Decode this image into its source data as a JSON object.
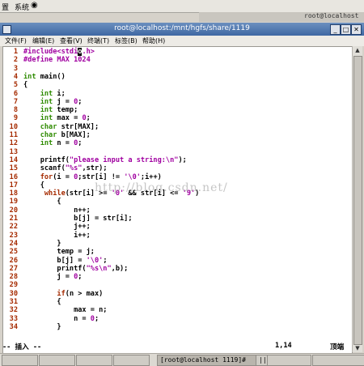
{
  "top_panel": {
    "menu_apps": "置",
    "menu_system": "系统"
  },
  "background_window": {
    "title_fragment": "root@localhost"
  },
  "window": {
    "title": "root@localhost:/mnt/hgfs/share/1119",
    "minimize": "_",
    "maximize": "□",
    "close": "✕"
  },
  "menu": {
    "file": "文件(F)",
    "edit": "编辑(E)",
    "view": "查看(V)",
    "terminal": "终端(T)",
    "tabs": "标签(B)",
    "help": "帮助(H)"
  },
  "colors": {
    "keyword": "#a52a00",
    "type": "#2e8b00",
    "preproc": "#a000a0",
    "string": "#a000a0",
    "number": "#a000a0",
    "plain": "#000000"
  },
  "code": [
    {
      "num": "1",
      "segs": [
        {
          "t": "#include<stdi",
          "c": "preproc"
        },
        {
          "t": "o",
          "c": "cursor"
        },
        {
          "t": ".h>",
          "c": "preproc"
        }
      ]
    },
    {
      "num": "2",
      "segs": [
        {
          "t": "#define MAX 1024",
          "c": "preproc"
        }
      ]
    },
    {
      "num": "3",
      "segs": []
    },
    {
      "num": "4",
      "segs": [
        {
          "t": "int",
          "c": "type"
        },
        {
          "t": " main()",
          "c": "plain"
        }
      ]
    },
    {
      "num": "5",
      "segs": [
        {
          "t": "{",
          "c": "plain"
        }
      ]
    },
    {
      "num": "6",
      "segs": [
        {
          "t": "    ",
          "c": "plain"
        },
        {
          "t": "int",
          "c": "type"
        },
        {
          "t": " i;",
          "c": "plain"
        }
      ]
    },
    {
      "num": "7",
      "segs": [
        {
          "t": "    ",
          "c": "plain"
        },
        {
          "t": "int",
          "c": "type"
        },
        {
          "t": " j = ",
          "c": "plain"
        },
        {
          "t": "0",
          "c": "number"
        },
        {
          "t": ";",
          "c": "plain"
        }
      ]
    },
    {
      "num": "8",
      "segs": [
        {
          "t": "    ",
          "c": "plain"
        },
        {
          "t": "int",
          "c": "type"
        },
        {
          "t": " temp;",
          "c": "plain"
        }
      ]
    },
    {
      "num": "9",
      "segs": [
        {
          "t": "    ",
          "c": "plain"
        },
        {
          "t": "int",
          "c": "type"
        },
        {
          "t": " max = ",
          "c": "plain"
        },
        {
          "t": "0",
          "c": "number"
        },
        {
          "t": ";",
          "c": "plain"
        }
      ]
    },
    {
      "num": "10",
      "segs": [
        {
          "t": "    ",
          "c": "plain"
        },
        {
          "t": "char",
          "c": "type"
        },
        {
          "t": " str[MAX];",
          "c": "plain"
        }
      ]
    },
    {
      "num": "11",
      "segs": [
        {
          "t": "    ",
          "c": "plain"
        },
        {
          "t": "char",
          "c": "type"
        },
        {
          "t": " b[MAX];",
          "c": "plain"
        }
      ]
    },
    {
      "num": "12",
      "segs": [
        {
          "t": "    ",
          "c": "plain"
        },
        {
          "t": "int",
          "c": "type"
        },
        {
          "t": " n = ",
          "c": "plain"
        },
        {
          "t": "0",
          "c": "number"
        },
        {
          "t": ";",
          "c": "plain"
        }
      ]
    },
    {
      "num": "13",
      "segs": []
    },
    {
      "num": "14",
      "segs": [
        {
          "t": "    printf(",
          "c": "plain"
        },
        {
          "t": "\"please input a string:\\n\"",
          "c": "string"
        },
        {
          "t": ");",
          "c": "plain"
        }
      ]
    },
    {
      "num": "15",
      "segs": [
        {
          "t": "    scanf(",
          "c": "plain"
        },
        {
          "t": "\"%s\"",
          "c": "string"
        },
        {
          "t": ",str);",
          "c": "plain"
        }
      ]
    },
    {
      "num": "16",
      "segs": [
        {
          "t": "    ",
          "c": "plain"
        },
        {
          "t": "for",
          "c": "keyword"
        },
        {
          "t": "(i = ",
          "c": "plain"
        },
        {
          "t": "0",
          "c": "number"
        },
        {
          "t": ";str[i] != ",
          "c": "plain"
        },
        {
          "t": "'\\0'",
          "c": "string"
        },
        {
          "t": ";i++)",
          "c": "plain"
        }
      ]
    },
    {
      "num": "17",
      "segs": [
        {
          "t": "    {",
          "c": "plain"
        }
      ]
    },
    {
      "num": "18",
      "segs": [
        {
          "t": "     ",
          "c": "plain"
        },
        {
          "t": "while",
          "c": "keyword"
        },
        {
          "t": "(str[i] >= ",
          "c": "plain"
        },
        {
          "t": "'0'",
          "c": "string"
        },
        {
          "t": " && str[i] <= ",
          "c": "plain"
        },
        {
          "t": "'9'",
          "c": "string"
        },
        {
          "t": ")",
          "c": "plain"
        }
      ]
    },
    {
      "num": "19",
      "segs": [
        {
          "t": "        {",
          "c": "plain"
        }
      ]
    },
    {
      "num": "20",
      "segs": [
        {
          "t": "            n++;",
          "c": "plain"
        }
      ]
    },
    {
      "num": "21",
      "segs": [
        {
          "t": "            b[j] = str[i];",
          "c": "plain"
        }
      ]
    },
    {
      "num": "22",
      "segs": [
        {
          "t": "            j++;",
          "c": "plain"
        }
      ]
    },
    {
      "num": "23",
      "segs": [
        {
          "t": "            i++;",
          "c": "plain"
        }
      ]
    },
    {
      "num": "24",
      "segs": [
        {
          "t": "        }",
          "c": "plain"
        }
      ]
    },
    {
      "num": "25",
      "segs": [
        {
          "t": "        temp = j;",
          "c": "plain"
        }
      ]
    },
    {
      "num": "26",
      "segs": [
        {
          "t": "        b[j] = ",
          "c": "plain"
        },
        {
          "t": "'\\0'",
          "c": "string"
        },
        {
          "t": ";",
          "c": "plain"
        }
      ]
    },
    {
      "num": "27",
      "segs": [
        {
          "t": "        printf(",
          "c": "plain"
        },
        {
          "t": "\"%s\\n\"",
          "c": "string"
        },
        {
          "t": ",b);",
          "c": "plain"
        }
      ]
    },
    {
      "num": "28",
      "segs": [
        {
          "t": "        j = ",
          "c": "plain"
        },
        {
          "t": "0",
          "c": "number"
        },
        {
          "t": ";",
          "c": "plain"
        }
      ]
    },
    {
      "num": "29",
      "segs": []
    },
    {
      "num": "30",
      "segs": [
        {
          "t": "        ",
          "c": "plain"
        },
        {
          "t": "if",
          "c": "keyword"
        },
        {
          "t": "(n > max)",
          "c": "plain"
        }
      ]
    },
    {
      "num": "31",
      "segs": [
        {
          "t": "        {",
          "c": "plain"
        }
      ]
    },
    {
      "num": "32",
      "segs": [
        {
          "t": "            max = n;",
          "c": "plain"
        }
      ]
    },
    {
      "num": "33",
      "segs": [
        {
          "t": "            n = ",
          "c": "plain"
        },
        {
          "t": "0",
          "c": "number"
        },
        {
          "t": ";",
          "c": "plain"
        }
      ]
    },
    {
      "num": "34",
      "segs": [
        {
          "t": "        }",
          "c": "plain"
        }
      ]
    }
  ],
  "statusline": {
    "mode": "-- 插入 --",
    "position": "1,14",
    "scroll": "顶端"
  },
  "watermark": "http://blog.csdn.net/",
  "taskbar": {
    "item_active": "[root@localhost 1119]#",
    "cursor_mark": "||"
  }
}
